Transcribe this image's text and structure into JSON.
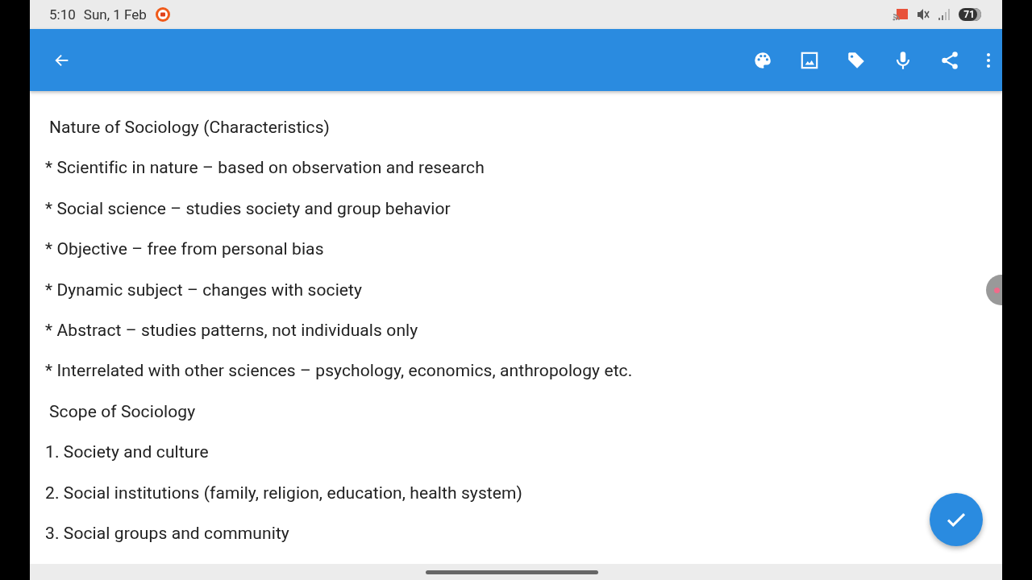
{
  "status_bar": {
    "time": "5:10",
    "date": "Sun, 1 Feb",
    "battery": "71"
  },
  "note": {
    "lines": [
      {
        "kind": "heading",
        "text": "Nature of Sociology (Characteristics)"
      },
      {
        "kind": "item",
        "text": "* Scientific in nature – based on observation and research"
      },
      {
        "kind": "item",
        "text": "* Social science – studies society and group behavior"
      },
      {
        "kind": "item",
        "text": "* Objective – free from personal bias"
      },
      {
        "kind": "item",
        "text": "* Dynamic subject – changes with society"
      },
      {
        "kind": "item",
        "text": "* Abstract – studies patterns, not individuals only"
      },
      {
        "kind": "item",
        "text": "* Interrelated with other sciences – psychology, economics, anthropology etc."
      },
      {
        "kind": "heading",
        "text": "Scope of Sociology"
      },
      {
        "kind": "item",
        "text": "1. Society and culture"
      },
      {
        "kind": "item",
        "text": "2. Social institutions (family, religion, education, health system)"
      },
      {
        "kind": "item",
        "text": "3. Social groups and community"
      }
    ]
  }
}
